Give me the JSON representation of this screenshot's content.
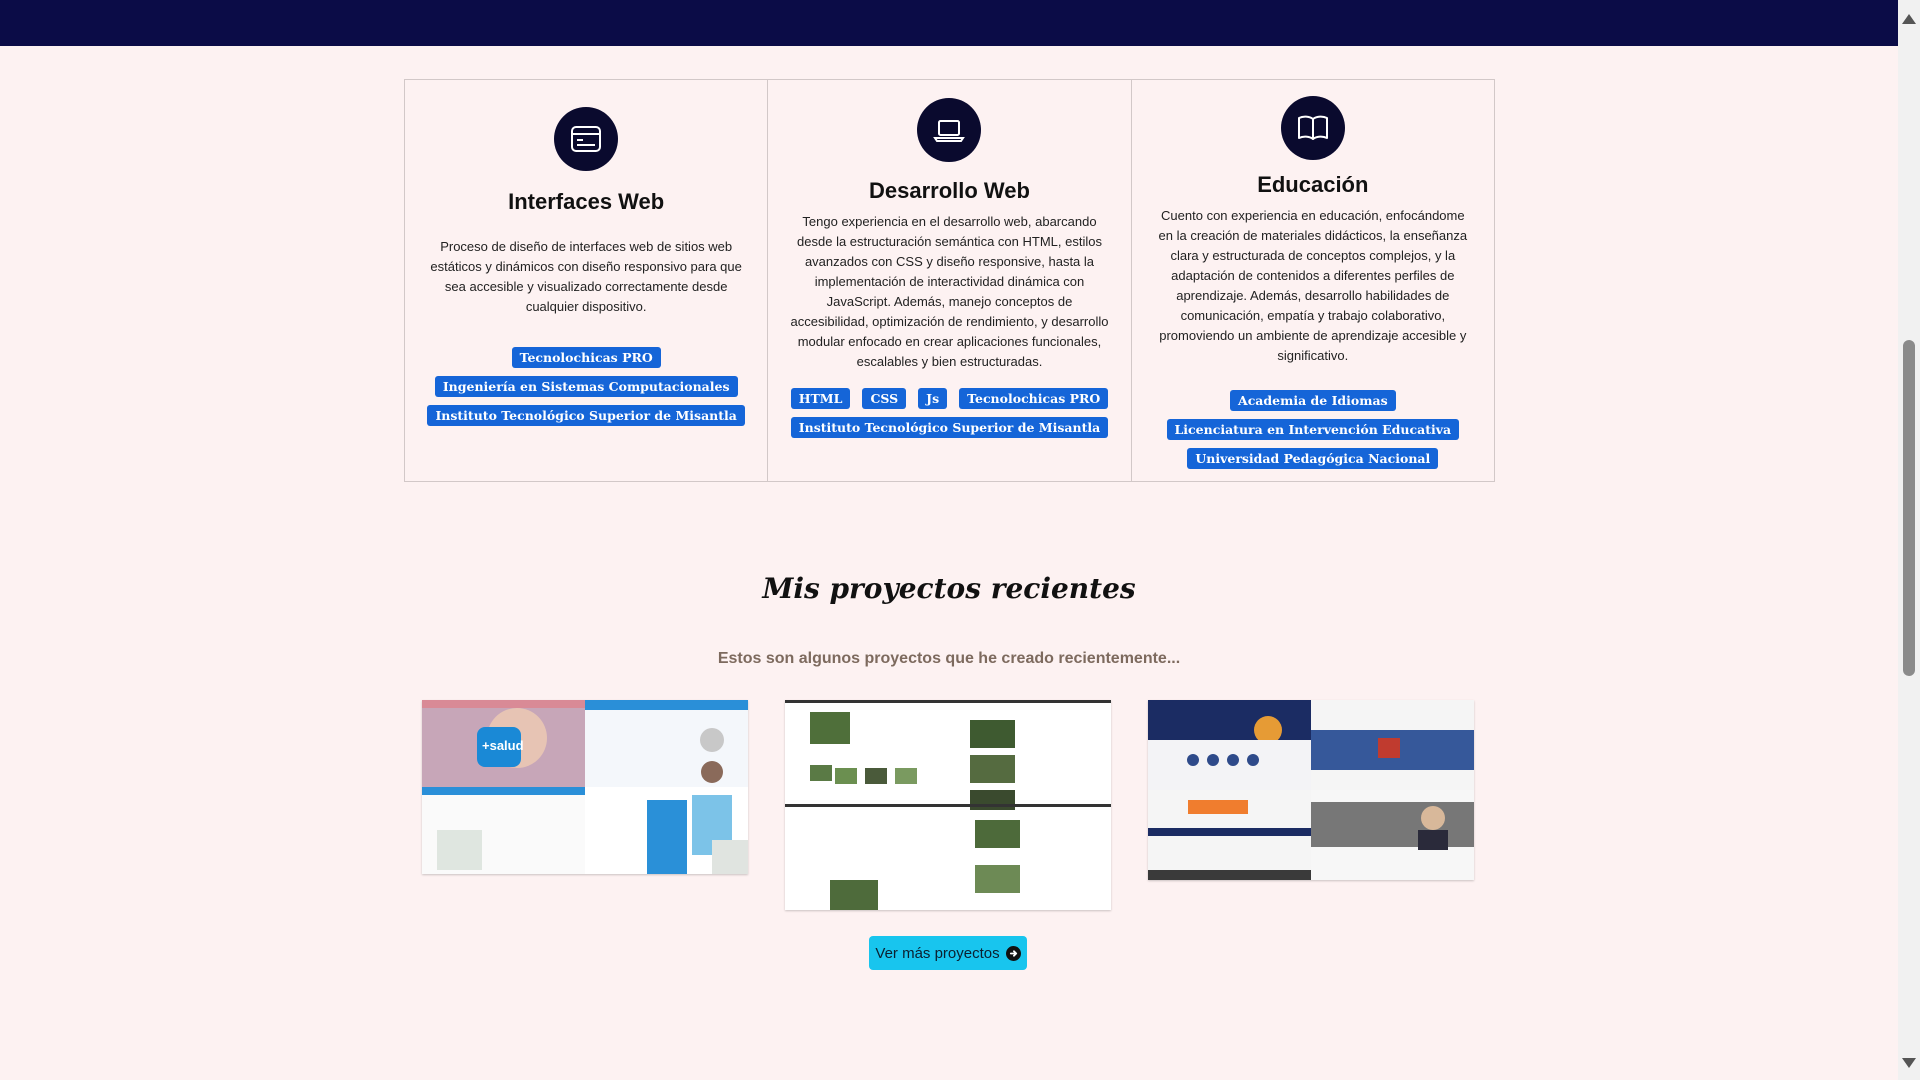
{
  "services": [
    {
      "icon": "browser-window-icon",
      "title": "Interfaces Web",
      "description": "Proceso de diseño de interfaces web de sitios web estáticos y dinámicos con diseño responsivo para que sea accesible y visualizado correctamente desde cualquier dispositivo.",
      "tags": [
        "Tecnolochicas PRO",
        "Ingeniería en Sistemas Computacionales",
        "Instituto Tecnológico Superior de Misantla"
      ]
    },
    {
      "icon": "laptop-icon",
      "title": "Desarrollo Web",
      "description": "Tengo experiencia en el desarrollo web, abarcando desde la estructuración semántica con HTML, estilos avanzados con CSS y diseño responsive, hasta la implementación de interactividad dinámica con JavaScript. Además, manejo conceptos de accesibilidad, optimización de rendimiento, y desarrollo modular enfocado en crear aplicaciones funcionales, escalables y bien estructuradas.",
      "tags": [
        "HTML",
        "CSS",
        "Js",
        "Tecnolochicas PRO",
        "Instituto Tecnológico Superior de Misantla"
      ]
    },
    {
      "icon": "open-book-icon",
      "title": "Educación",
      "description": "Cuento con experiencia en educación, enfocándome en la creación de materiales didácticos, la enseñanza clara y estructurada de conceptos complejos, y la adaptación de contenidos a diferentes perfiles de aprendizaje. Además, desarrollo habilidades de comunicación, empatía y trabajo colaborativo, promoviendo un ambiente de aprendizaje accesible y significativo.",
      "tags": [
        "Academia de Idiomas",
        "Licenciatura en Intervención Educativa",
        "Universidad Pedagógica Nacional"
      ]
    }
  ],
  "projects": {
    "title": "Mis proyectos recientes",
    "subtitle": "Estos son algunos proyectos que he creado recientemente...",
    "thumb1_logo": "+salud",
    "button_label": "Ver más proyectos"
  }
}
